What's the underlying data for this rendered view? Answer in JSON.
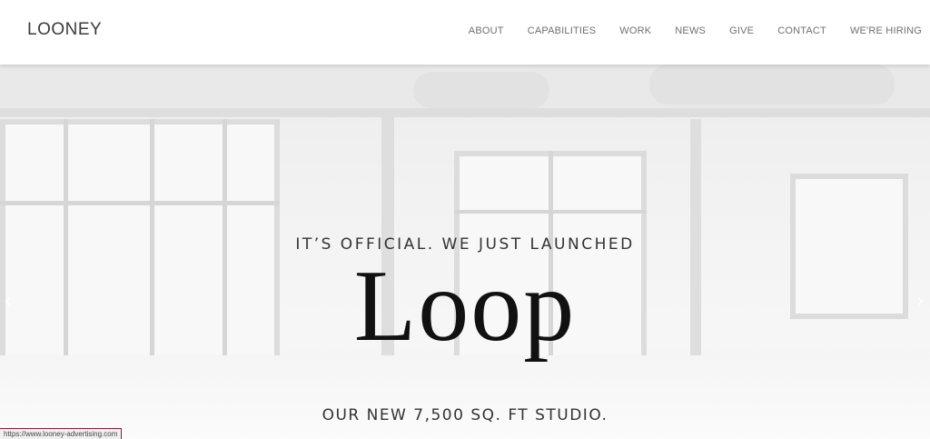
{
  "header": {
    "logo": "LOONEY",
    "nav": [
      "ABOUT",
      "CAPABILITIES",
      "WORK",
      "NEWS",
      "GIVE",
      "CONTACT",
      "WE'RE HIRING"
    ]
  },
  "hero": {
    "kicker": "IT’S OFFICIAL. WE JUST LAUNCHED",
    "headline": "Loop",
    "subline": "OUR NEW 7,500 SQ. FT STUDIO.",
    "prev_arrow": "‹",
    "next_arrow": "›"
  },
  "status_bar": {
    "url": "https://www.looney-advertising.com"
  }
}
